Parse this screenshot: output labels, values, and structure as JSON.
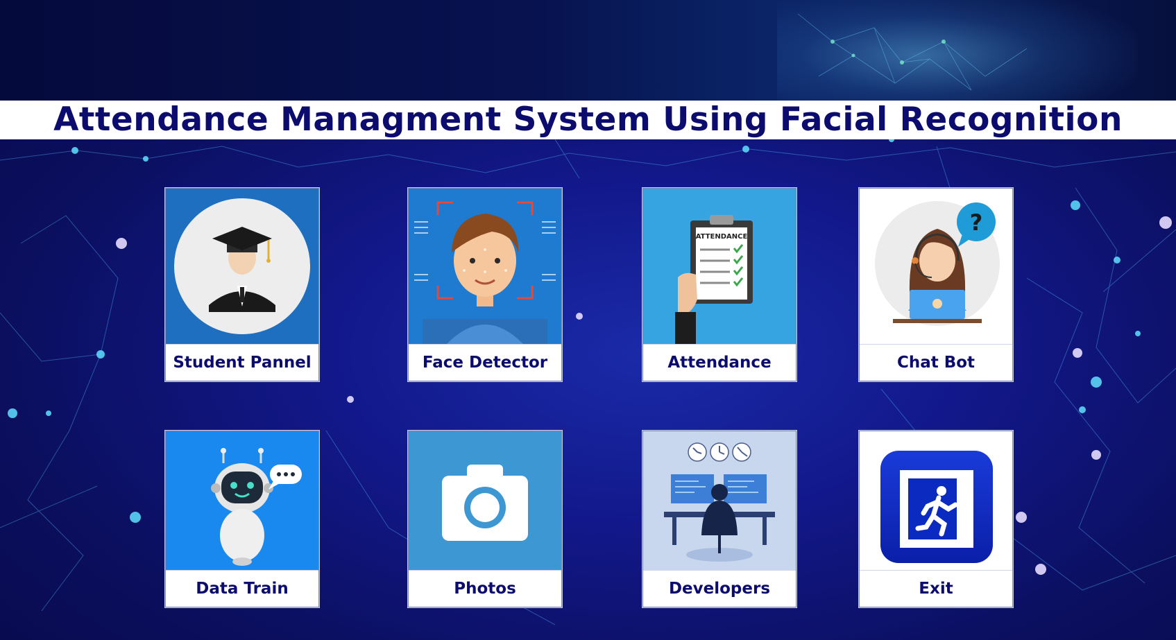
{
  "title": "Attendance Managment System Using Facial Recognition",
  "tiles": [
    {
      "label": "Student Pannel",
      "icon": "graduate-icon"
    },
    {
      "label": "Face Detector",
      "icon": "face-scan-icon"
    },
    {
      "label": "Attendance",
      "icon": "attendance-clipboard-icon"
    },
    {
      "label": "Chat Bot",
      "icon": "support-agent-icon"
    },
    {
      "label": "Data Train",
      "icon": "robot-icon"
    },
    {
      "label": "Photos",
      "icon": "camera-icon"
    },
    {
      "label": "Developers",
      "icon": "developer-desk-icon"
    },
    {
      "label": "Exit",
      "icon": "exit-door-icon"
    }
  ],
  "colors": {
    "title_text": "#0c0c6e",
    "background": "#12188a",
    "tile_blue": "#1f7bd0",
    "tile_light_blue": "#35a4e0"
  }
}
